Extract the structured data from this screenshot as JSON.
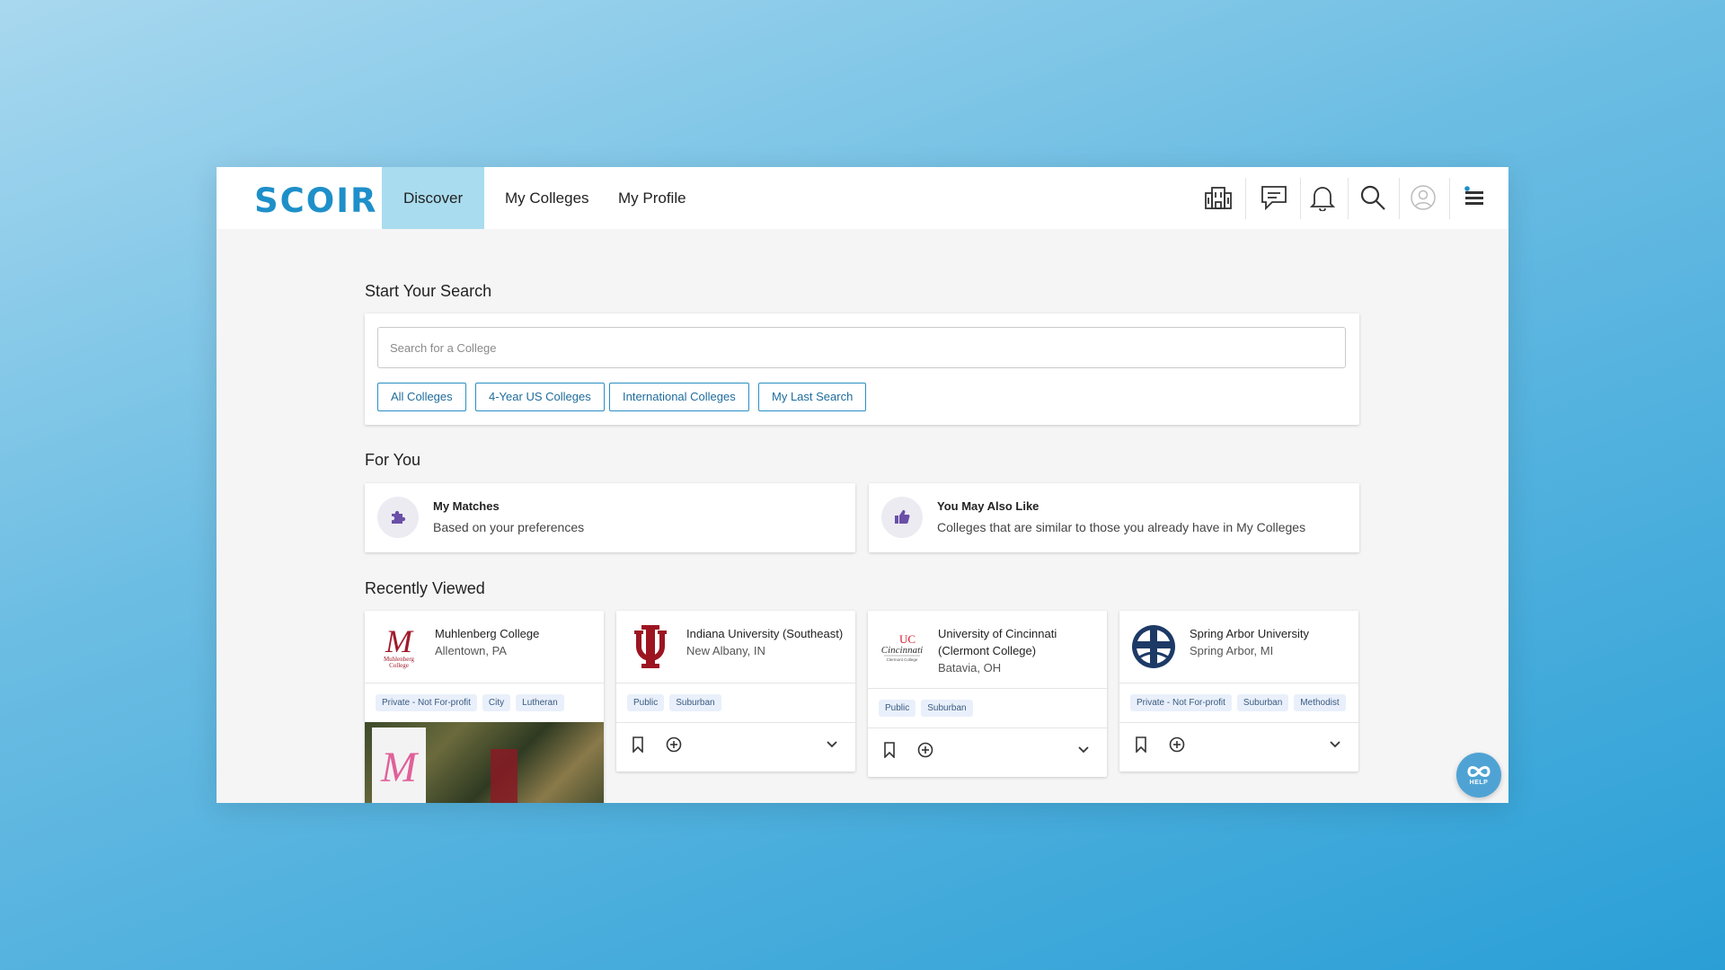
{
  "app": {
    "logo": "SCOIR",
    "nav": [
      {
        "label": "Discover",
        "active": true
      },
      {
        "label": "My Colleges",
        "active": false
      },
      {
        "label": "My Profile",
        "active": false
      }
    ],
    "header_icons": [
      "school-building-icon",
      "chat-icon",
      "bell-icon",
      "search-icon",
      "user-avatar-icon",
      "menu-icon"
    ],
    "accent_color": "#1e8fc9",
    "active_tab_color": "#a9dcef"
  },
  "search": {
    "section_title": "Start Your Search",
    "placeholder": "Search for a College",
    "value": "",
    "quick_filters": [
      "All Colleges",
      "4-Year US Colleges",
      "International Colleges",
      "My Last Search"
    ]
  },
  "for_you": {
    "section_title": "For You",
    "cards": [
      {
        "title": "My Matches",
        "subtitle": "Based on your preferences",
        "icon": "puzzle-icon"
      },
      {
        "title": "You May Also Like",
        "subtitle": "Colleges that are similar to those you already have in My Colleges",
        "icon": "thumbs-up-icon"
      }
    ]
  },
  "recently_viewed": {
    "section_title": "Recently Viewed",
    "colleges": [
      {
        "name": "Muhlenberg College",
        "location": "Allentown, PA",
        "tags": [
          "Private - Not For-profit",
          "City",
          "Lutheran"
        ],
        "logo_text": "Muhlenberg College"
      },
      {
        "name": "Indiana University (Southeast)",
        "location": "New Albany, IN",
        "tags": [
          "Public",
          "Suburban"
        ]
      },
      {
        "name": "University of Cincinnati (Clermont College)",
        "location": "Batavia, OH",
        "tags": [
          "Public",
          "Suburban"
        ],
        "logo_text": "Cincinnati"
      },
      {
        "name": "Spring Arbor University",
        "location": "Spring Arbor, MI",
        "tags": [
          "Private - Not For-profit",
          "Suburban",
          "Methodist"
        ]
      }
    ]
  },
  "help": {
    "label": "HELP"
  }
}
